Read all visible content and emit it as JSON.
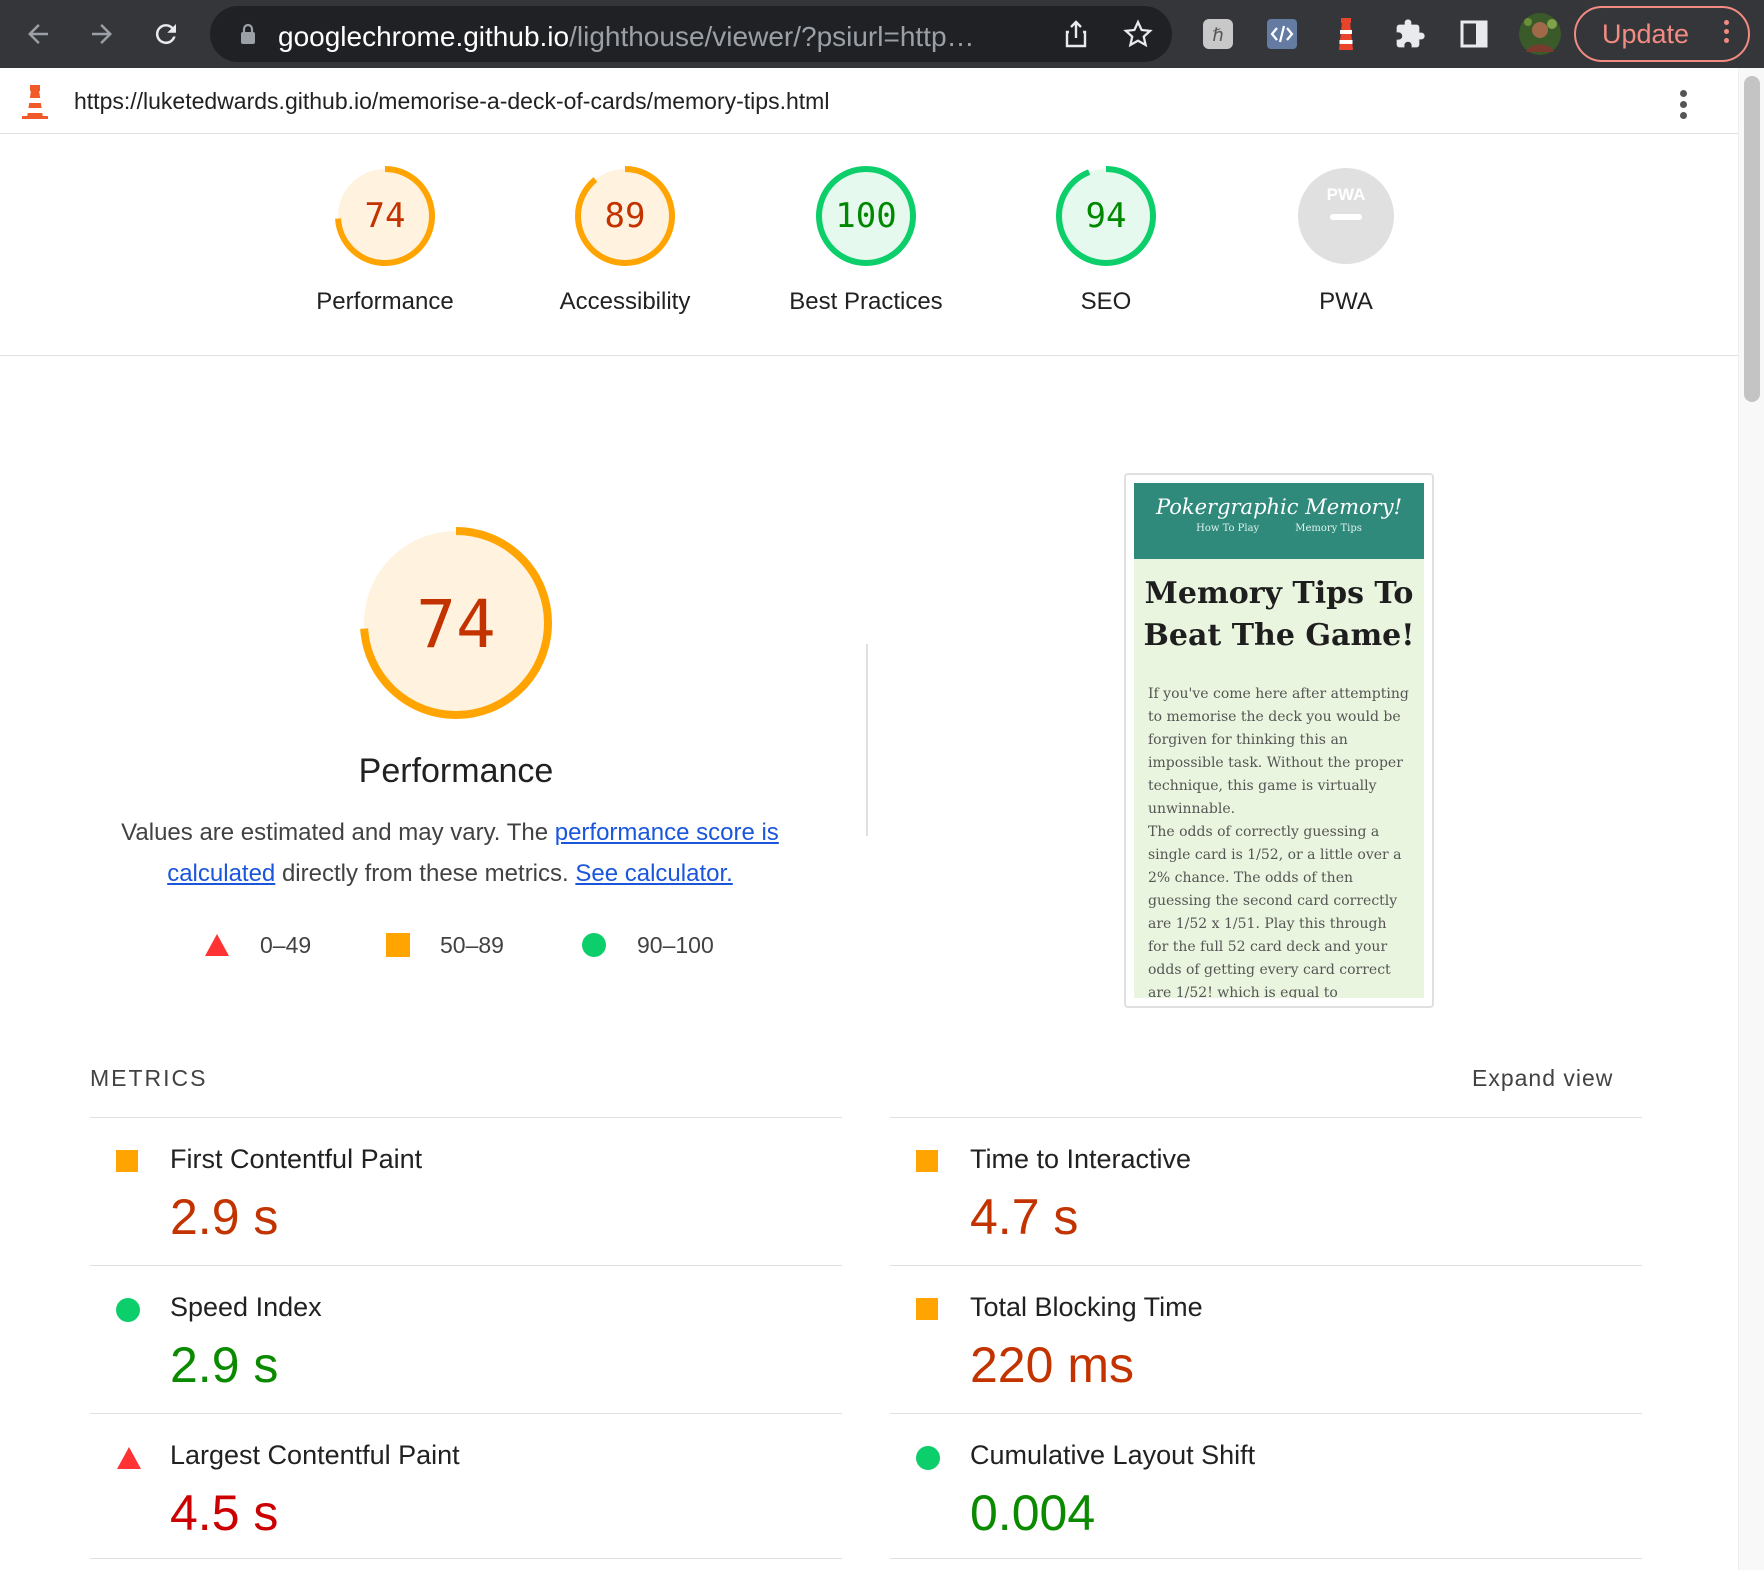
{
  "browser": {
    "url_domain": "googlechrome.github.io",
    "url_path": "/lighthouse/viewer/?psiurl=http…",
    "update_label": "Update"
  },
  "report": {
    "url": "https://luketedwards.github.io/memorise-a-deck-of-cards/memory-tips.html"
  },
  "gauges": [
    {
      "score": "74",
      "label": "Performance",
      "value": 74,
      "rating": "average"
    },
    {
      "score": "89",
      "label": "Accessibility",
      "value": 89,
      "rating": "average"
    },
    {
      "score": "100",
      "label": "Best Practices",
      "value": 100,
      "rating": "pass"
    },
    {
      "score": "94",
      "label": "SEO",
      "value": 94,
      "rating": "pass"
    },
    {
      "score": "PWA",
      "label": "PWA",
      "value": null,
      "rating": "na"
    }
  ],
  "performance": {
    "score": "74",
    "title": "Performance",
    "desc_prefix": "Values are estimated and may vary. The ",
    "desc_link1": "performance score is calculated",
    "desc_middle": " directly from these metrics. ",
    "desc_link2": "See calculator.",
    "legend": [
      {
        "range": "0–49",
        "shape": "triangle",
        "color": "#ff3333"
      },
      {
        "range": "50–89",
        "shape": "square",
        "color": "#ffa400"
      },
      {
        "range": "90–100",
        "shape": "circle",
        "color": "#0cce6b"
      }
    ]
  },
  "thumbnail": {
    "brand": "Pokergraphic Memory!",
    "nav1": "How To Play",
    "nav2": "Memory Tips",
    "heading": "Memory Tips To Beat The Game!",
    "para1": "If you've come here after attempting to memorise the deck you would be forgiven for thinking this an impossible task. Without the proper technique, this game is virtually unwinnable.",
    "para2": "The odds of correctly guessing a single card is 1/52, or a little over a 2% chance. The odds of then guessing the second card correctly are 1/52 x 1/51. Play this through for the full 52 card deck and your odds of getting every card correct are 1/52! which is equal to"
  },
  "metrics": {
    "heading": "METRICS",
    "expand_label": "Expand view",
    "items": [
      {
        "name": "First Contentful Paint",
        "value": "2.9 s",
        "rating": "average"
      },
      {
        "name": "Time to Interactive",
        "value": "4.7 s",
        "rating": "average"
      },
      {
        "name": "Speed Index",
        "value": "2.9 s",
        "rating": "pass"
      },
      {
        "name": "Total Blocking Time",
        "value": "220 ms",
        "rating": "average"
      },
      {
        "name": "Largest Contentful Paint",
        "value": "4.5 s",
        "rating": "fail"
      },
      {
        "name": "Cumulative Layout Shift",
        "value": "0.004",
        "rating": "pass"
      }
    ]
  },
  "colors": {
    "average_fg": "#c33300",
    "average_ring": "#ffa400",
    "average_bg": "#fff3e0",
    "pass_fg": "#008800",
    "pass_ring": "#0cce6b",
    "pass_bg": "#e6f9ee",
    "fail_fg": "#cc0000",
    "fail_icon": "#ff3333",
    "na_bg": "#e0e0e0"
  }
}
